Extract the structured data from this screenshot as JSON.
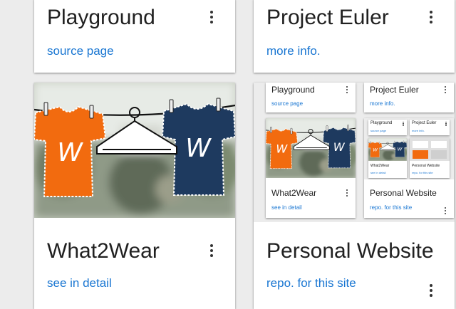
{
  "cards": {
    "playground": {
      "title": "Playground",
      "link": "source page"
    },
    "euler": {
      "title": "Project Euler",
      "link": "more info."
    },
    "what2wear": {
      "title": "What2Wear",
      "link": "see in detail",
      "logo_letter": "W"
    },
    "personal": {
      "title": "Personal Website",
      "link": "repo. for this site"
    }
  },
  "preview": {
    "playground": {
      "title": "Playground",
      "link": "source page"
    },
    "euler": {
      "title": "Project Euler",
      "link": "more info."
    },
    "what2wear": {
      "title": "What2Wear",
      "link": "see in detail"
    },
    "personal": {
      "title": "Personal Website",
      "link": "repo. for this site"
    },
    "nested": {
      "playground": {
        "title": "Playground",
        "link": "source page"
      },
      "euler": {
        "title": "Project Euler",
        "link": "more info."
      },
      "what2wear": {
        "title": "What2Wear",
        "link": "see in detail"
      },
      "personal": {
        "title": "Personal Website",
        "link": "repo. for this site"
      }
    }
  },
  "colors": {
    "accent_link": "#1976d2",
    "shirt_orange": "#f26b0f",
    "shirt_navy": "#1e3a5f",
    "card_bg": "#ffffff",
    "page_bg": "#ececec"
  },
  "icons": {
    "menu": "more-vert-icon",
    "hanger": "clothes-hanger-icon",
    "tshirt": "tshirt-icon"
  }
}
